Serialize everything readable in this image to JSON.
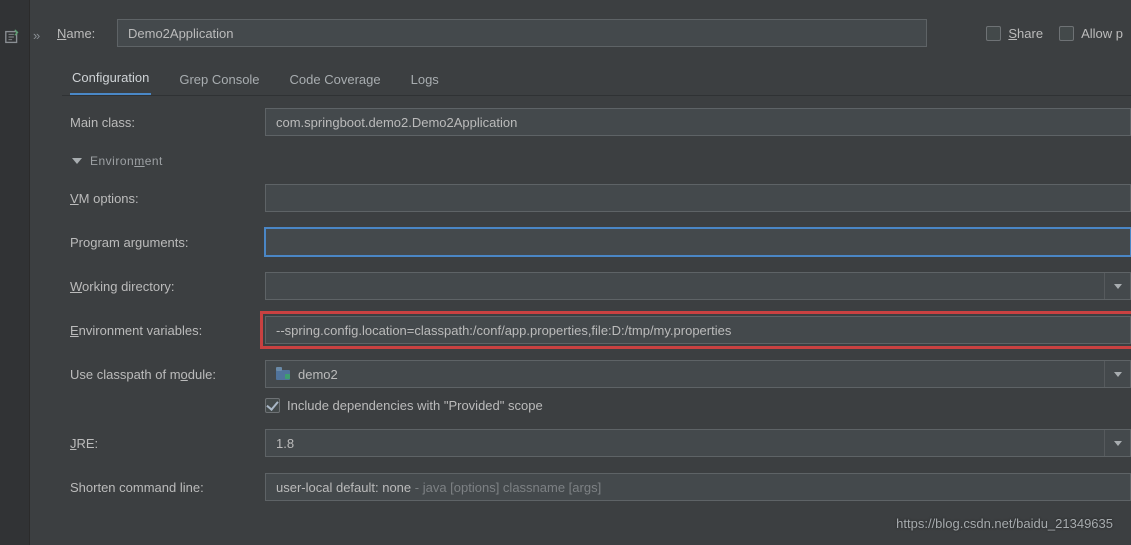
{
  "top": {
    "name_label_pre": "N",
    "name_label_post": "ame:",
    "name_value": "Demo2Application",
    "share_pre": "S",
    "share_post": "hare",
    "allow_label": "Allow p"
  },
  "tabs": {
    "configuration": "Configuration",
    "grep": "Grep Console",
    "coverage": "Code Coverage",
    "logs": "Logs"
  },
  "form": {
    "main_class_label": "Main class:",
    "main_class_value": "com.springboot.demo2.Demo2Application",
    "env_header_pre": "Environ",
    "env_header_u": "m",
    "env_header_post": "ent",
    "vm_pre": "V",
    "vm_post": "M options:",
    "args_pre": "Program ar",
    "args_u": "g",
    "args_post": "uments:",
    "args_value": "",
    "workdir_pre": "W",
    "workdir_post": "orking directory:",
    "envvars_pre": "E",
    "envvars_post": "nvironment variables:",
    "envvars_value": "--spring.config.location=classpath:/conf/app.properties,file:D:/tmp/my.properties",
    "module_pre": "Use classpath of m",
    "module_u": "o",
    "module_post": "dule:",
    "module_value": "demo2",
    "include_label": "Include dependencies with \"Provided\" scope",
    "include_checked": true,
    "jre_pre": "J",
    "jre_post": "RE:",
    "jre_value": "1.8",
    "shorten_label": "Shorten command line:",
    "shorten_value_a": "user-local default: none",
    "shorten_value_b": " - java [options] classname [args]"
  },
  "watermark": "https://blog.csdn.net/baidu_21349635"
}
